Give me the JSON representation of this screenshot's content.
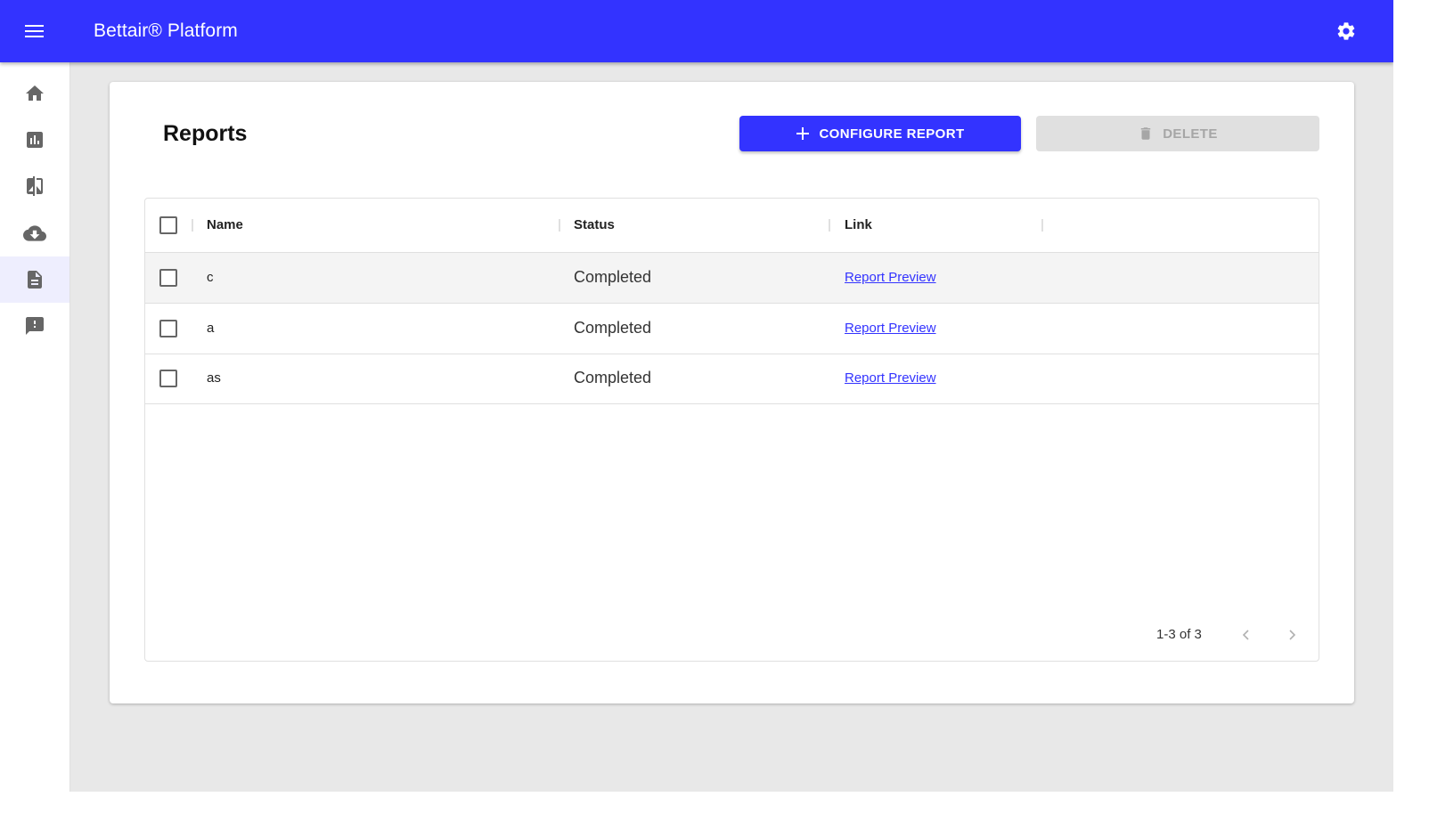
{
  "header": {
    "title": "Bettair® Platform",
    "menu_icon": "hamburger-menu-icon",
    "settings_icon": "gear-icon"
  },
  "sidebar": {
    "items": [
      {
        "name": "home",
        "icon": "home-icon",
        "active": false
      },
      {
        "name": "analytics",
        "icon": "bar-chart-icon",
        "active": false
      },
      {
        "name": "compare",
        "icon": "compare-icon",
        "active": false
      },
      {
        "name": "download",
        "icon": "cloud-download-icon",
        "active": false
      },
      {
        "name": "reports",
        "icon": "document-icon",
        "active": true
      },
      {
        "name": "feedback",
        "icon": "feedback-icon",
        "active": false
      }
    ]
  },
  "page": {
    "title": "Reports",
    "configure_label": "CONFIGURE REPORT",
    "delete_label": "DELETE"
  },
  "table": {
    "columns": [
      "Name",
      "Status",
      "Link"
    ],
    "rows": [
      {
        "name": "c",
        "status": "Completed",
        "link": "Report Preview"
      },
      {
        "name": "a",
        "status": "Completed",
        "link": "Report Preview"
      },
      {
        "name": "as",
        "status": "Completed",
        "link": "Report Preview"
      }
    ],
    "pagination": "1-3 of 3"
  },
  "colors": {
    "primary": "#3333ff",
    "background": "#e8e8e8",
    "disabled": "#e0e0e0"
  }
}
